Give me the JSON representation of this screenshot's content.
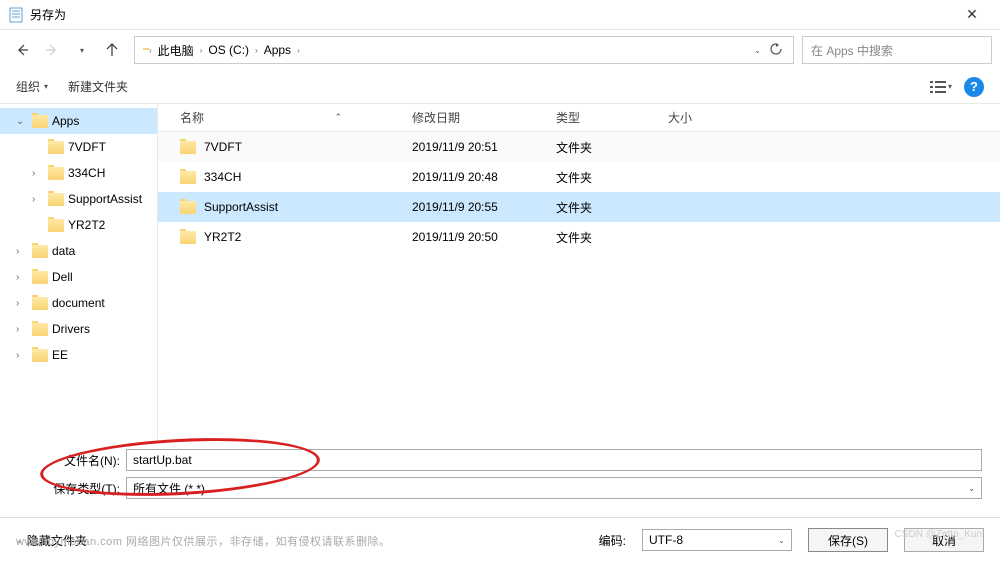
{
  "titlebar": {
    "title": "另存为"
  },
  "nav": {
    "back": "←",
    "forward": "→",
    "up": "↑"
  },
  "breadcrumb": {
    "items": [
      "此电脑",
      "OS (C:)",
      "Apps"
    ],
    "search_placeholder": "在 Apps 中搜索"
  },
  "toolbar": {
    "organize": "组织",
    "new_folder": "新建文件夹"
  },
  "tree": {
    "items": [
      {
        "label": "Apps",
        "indent": 1,
        "expanded": true,
        "selected": true,
        "hasExpander": true
      },
      {
        "label": "7VDFT",
        "indent": 2,
        "hasExpander": false
      },
      {
        "label": "334CH",
        "indent": 2,
        "hasExpander": true
      },
      {
        "label": "SupportAssist",
        "indent": 2,
        "hasExpander": true
      },
      {
        "label": "YR2T2",
        "indent": 2,
        "hasExpander": false
      },
      {
        "label": "data",
        "indent": 1,
        "hasExpander": true
      },
      {
        "label": "Dell",
        "indent": 1,
        "hasExpander": true
      },
      {
        "label": "document",
        "indent": 1,
        "hasExpander": true
      },
      {
        "label": "Drivers",
        "indent": 1,
        "hasExpander": true
      },
      {
        "label": "EE",
        "indent": 1,
        "hasExpander": true
      }
    ]
  },
  "list": {
    "columns": {
      "name": "名称",
      "date": "修改日期",
      "type": "类型",
      "size": "大小"
    },
    "rows": [
      {
        "name": "7VDFT",
        "date": "2019/11/9 20:51",
        "type": "文件夹",
        "selected": false
      },
      {
        "name": "334CH",
        "date": "2019/11/9 20:48",
        "type": "文件夹",
        "selected": false
      },
      {
        "name": "SupportAssist",
        "date": "2019/11/9 20:55",
        "type": "文件夹",
        "selected": true
      },
      {
        "name": "YR2T2",
        "date": "2019/11/9 20:50",
        "type": "文件夹",
        "selected": false
      }
    ]
  },
  "form": {
    "filename_label": "文件名(N):",
    "filename_value": "startUp.bat",
    "filetype_label": "保存类型(T):",
    "filetype_value": "所有文件  (*.*)"
  },
  "footer": {
    "hide_folders": "隐藏文件夹",
    "encoding_label": "编码:",
    "encoding_value": "UTF-8",
    "save": "保存(S)",
    "cancel": "取消"
  },
  "watermark": {
    "line1": "www.toymoban.com  网络图片仅供展示，非存储，如有侵权请联系删除。",
    "line2": "CSDN @Zetto_Kun"
  }
}
